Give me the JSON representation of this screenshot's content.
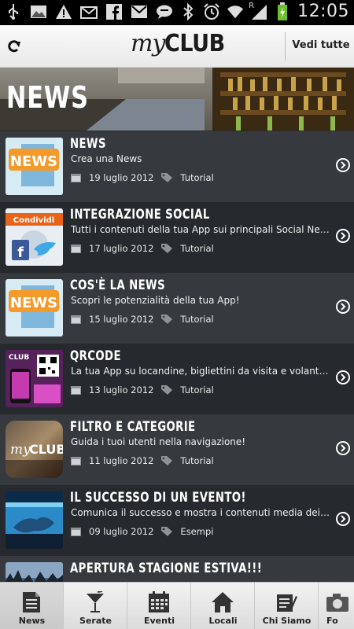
{
  "status_bar": {
    "time": "12:05",
    "left_icons": [
      "usb-icon",
      "image-icon",
      "warning-icon",
      "email-icon",
      "facebook-icon",
      "gmail-icon",
      "chat-icon"
    ],
    "right_icons": [
      "bluetooth-icon",
      "alarm-icon",
      "wifi-icon",
      "signal-icon",
      "battery-charging-icon"
    ],
    "roaming_label": "R"
  },
  "header": {
    "logo_my": "my",
    "logo_club": "CLUB",
    "see_all": "Vedi tutte"
  },
  "banner": {
    "title": "NEWS"
  },
  "news": [
    {
      "title": "NEWS",
      "subtitle": "Crea una News",
      "date": "19 luglio 2012",
      "category": "Tutorial",
      "thumb": "news"
    },
    {
      "title": "INTEGRAZIONE SOCIAL",
      "subtitle": "Tutti i contenuti della tua App sui principali Social Network!",
      "date": "17 luglio 2012",
      "category": "Tutorial",
      "thumb": "social",
      "thumb_label": "Condividi"
    },
    {
      "title": "COS'È LA NEWS",
      "subtitle": "Scopri le potenzialità della tua App!",
      "date": "15 luglio 2012",
      "category": "Tutorial",
      "thumb": "news"
    },
    {
      "title": "QRCODE",
      "subtitle": "La tua App su locandine, bigliettini da visita e volantini!",
      "date": "13 luglio 2012",
      "category": "Tutorial",
      "thumb": "qrcode",
      "thumb_label": "CLUB"
    },
    {
      "title": "FILTRO E CATEGORIE",
      "subtitle": "Guida i tuoi utenti nella navigazione!",
      "date": "11 luglio 2012",
      "category": "Tutorial",
      "thumb": "myclub",
      "thumb_label_my": "my",
      "thumb_label_club": "CLUB"
    },
    {
      "title": "IL SUCCESSO DI UN EVENTO!",
      "subtitle": "Comunica il successo e mostra i contenuti media dei tuoi eventi",
      "date": "09 luglio 2012",
      "category": "Esempi",
      "thumb": "pool"
    },
    {
      "title": "APERTURA STAGIONE ESTIVA!!!",
      "subtitle": "",
      "date": "",
      "category": "",
      "thumb": "crowd"
    }
  ],
  "news_thumb_word": "NEWS",
  "tabs": [
    {
      "label": "News",
      "icon": "news-document-icon"
    },
    {
      "label": "Serate",
      "icon": "cocktail-icon"
    },
    {
      "label": "Eventi",
      "icon": "calendar-icon"
    },
    {
      "label": "Locali",
      "icon": "house-icon"
    },
    {
      "label": "Chi Siamo",
      "icon": "edit-note-icon"
    },
    {
      "label": "Fo",
      "icon": "camera-icon"
    }
  ],
  "colors": {
    "row_odd": "#363a3f",
    "row_even": "#26292d",
    "header_bg": "#f2f2f2",
    "tabbar_bg": "#e6e6e6"
  }
}
